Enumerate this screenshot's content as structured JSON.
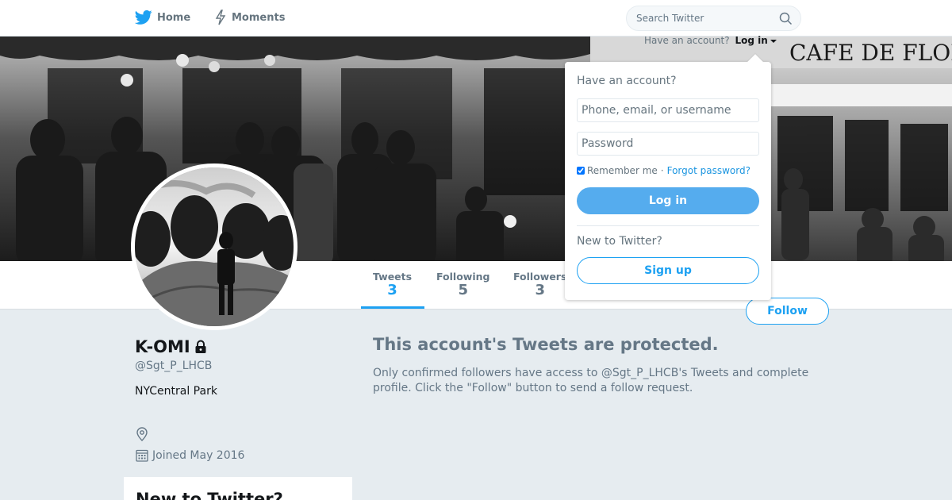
{
  "colors": {
    "accent": "#1da1f2",
    "text": "#14171a",
    "muted": "#657786",
    "background": "#e6ecf0"
  },
  "topnav": {
    "home_label": "Home",
    "home_icon": "twitter-bird-icon",
    "moments_label": "Moments",
    "moments_icon": "lightning-icon",
    "search_placeholder": "Search Twitter",
    "search_icon": "search-icon"
  },
  "login_strip": {
    "prompt": "Have an account?",
    "link": "Log in"
  },
  "profile_nav": {
    "stats": [
      {
        "label": "Tweets",
        "value": "3"
      },
      {
        "label": "Following",
        "value": "5"
      },
      {
        "label": "Followers",
        "value": "3"
      }
    ],
    "follow_label": "Follow"
  },
  "profile": {
    "name": "K-OMI",
    "handle": "@Sgt_P_LHCB",
    "bio": "NYCentral Park",
    "joined": "Joined May 2016",
    "protected_icon": "lock-icon",
    "location_icon": "location-pin-icon",
    "calendar_icon": "calendar-icon"
  },
  "protected": {
    "title": "This account's Tweets are protected.",
    "text": "Only confirmed followers have access to @Sgt_P_LHCB's Tweets and complete profile. Click the \"Follow\" button to send a follow request."
  },
  "sidebar_card": {
    "title": "New to Twitter?"
  },
  "login_dropdown": {
    "title": "Have an account?",
    "username_placeholder": "Phone, email, or username",
    "password_placeholder": "Password",
    "remember_label": "Remember me",
    "separator": "·",
    "forgot_label": "Forgot password?",
    "login_button": "Log in",
    "new_label": "New to Twitter?",
    "signup_button": "Sign up"
  }
}
